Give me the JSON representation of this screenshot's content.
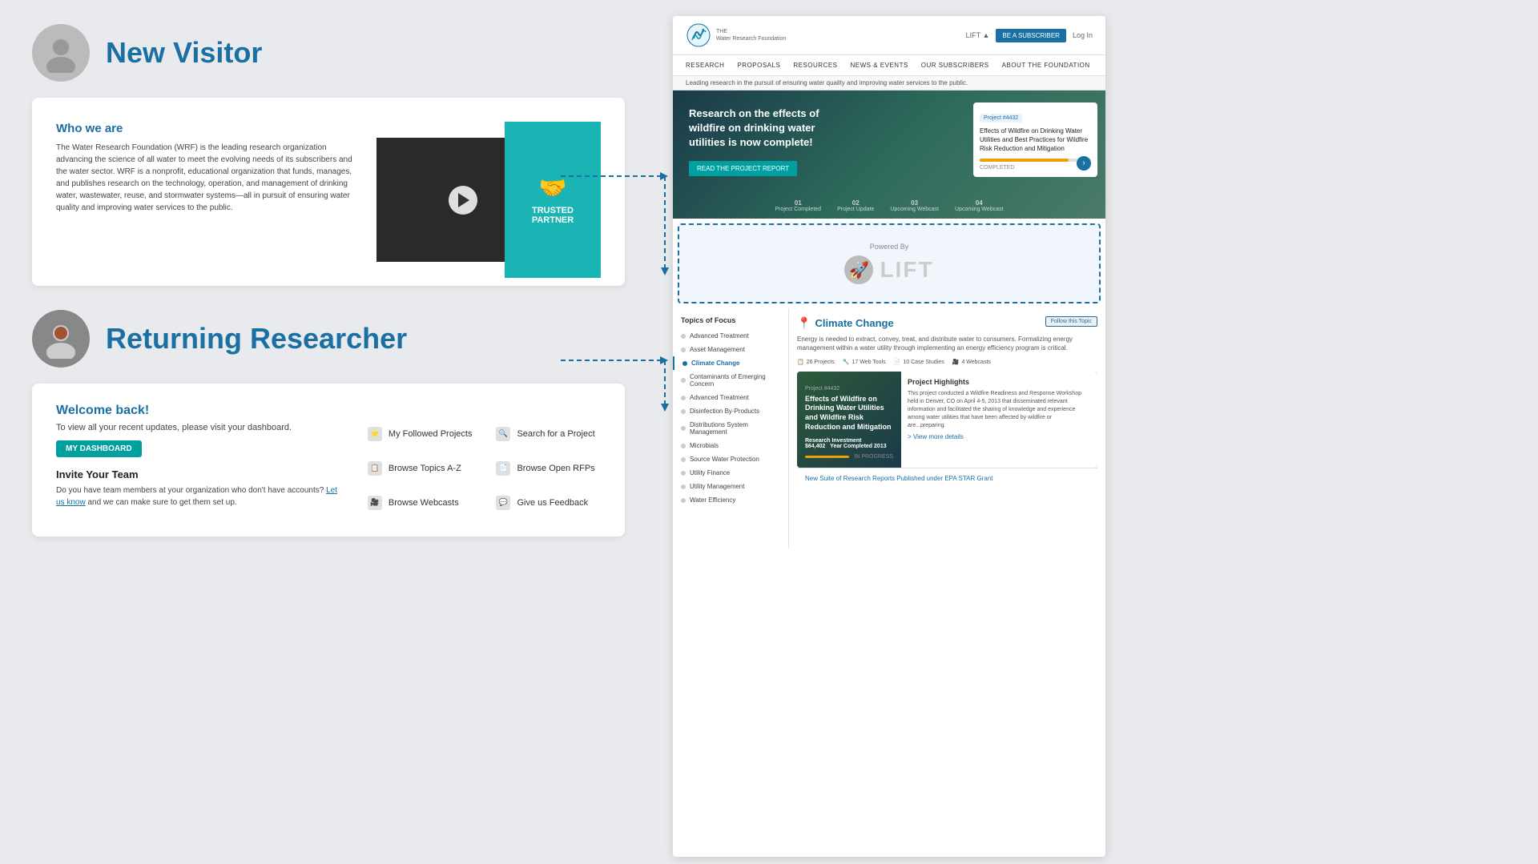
{
  "personas": {
    "new_visitor": {
      "title": "New Visitor",
      "avatar_label": "new-visitor-avatar"
    },
    "returning_researcher": {
      "title": "Returning Researcher",
      "avatar_label": "returning-researcher-avatar"
    }
  },
  "new_visitor_card": {
    "section_title": "Who we are",
    "description": "The Water Research Foundation (WRF) is the leading research organization advancing the science of all water to meet the evolving needs of its subscribers and the water sector. WRF is a nonprofit, educational organization that funds, manages, and publishes research on the technology, operation, and management of drinking water, wastewater, reuse, and stormwater systems—all in pursuit of ensuring water quality and improving water services to the public.",
    "video_overlay_text": "TRUSTED PARTNER"
  },
  "returning_card": {
    "welcome_title": "Welcome back!",
    "welcome_desc": "To view all your recent updates, please visit your dashboard.",
    "dashboard_btn": "MY DASHBOARD",
    "invite_title": "Invite Your Team",
    "invite_desc": "Do you have team members at your organization who don't have accounts?",
    "invite_link": "Let us know",
    "invite_suffix": " and we can make sure to get them set up.",
    "quick_links": [
      {
        "label": "My Followed Projects",
        "icon": "star-icon"
      },
      {
        "label": "Search for a Project",
        "icon": "search-icon"
      },
      {
        "label": "Browse Topics A-Z",
        "icon": "list-icon"
      },
      {
        "label": "Browse Open RFPs",
        "icon": "document-icon"
      },
      {
        "label": "Browse Webcasts",
        "icon": "video-icon"
      },
      {
        "label": "Give us Feedback",
        "icon": "feedback-icon"
      }
    ]
  },
  "wrf_website": {
    "header": {
      "logo_name": "Water Research Foundation",
      "logo_sub": "THE",
      "search_label": "LIFT ▲",
      "subscribe_btn": "BE A SUBSCRIBER",
      "login_label": "Log In"
    },
    "nav_items": [
      "RESEARCH",
      "PROPOSALS",
      "RESOURCES",
      "NEWS & EVENTS",
      "OUR SUBSCRIBERS",
      "ABOUT THE FOUNDATION"
    ],
    "tagline": "Leading research in the pursuit of ensuring water quality and improving water services to the public.",
    "hero": {
      "title": "Research on the effects of wildfire on drinking water utilities is now complete!",
      "cta_btn": "READ THE PROJECT REPORT",
      "card_tag": "Project #4432",
      "card_title": "Effects of Wildfire on Drinking Water Utilities and Best Practices for Wildfire Risk Reduction and Mitigation",
      "card_status": "COMPLETED",
      "nav_items": [
        {
          "num": "01",
          "label": "Project Completed"
        },
        {
          "num": "02",
          "label": "Project Update"
        },
        {
          "num": "03",
          "label": "Upcoming Webcast"
        },
        {
          "num": "04",
          "label": "Upcoming Webcast"
        }
      ]
    },
    "lift_box": {
      "powered_by": "Powered By",
      "logo_text": "LIFT"
    },
    "topics": {
      "title": "Topics of Focus",
      "items": [
        {
          "label": "Advanced Treatment",
          "active": false
        },
        {
          "label": "Asset Management",
          "active": false
        },
        {
          "label": "Climate Change",
          "active": true
        },
        {
          "label": "Contaminants of Emerging Concern",
          "active": false
        },
        {
          "label": "Advanced Treatment",
          "active": false
        },
        {
          "label": "Disinfection By-Products",
          "active": false
        },
        {
          "label": "Distributions System Management",
          "active": false
        },
        {
          "label": "Microbials",
          "active": false
        },
        {
          "label": "Source Water Protection",
          "active": false
        },
        {
          "label": "Utility Finance",
          "active": false
        },
        {
          "label": "Utility Management",
          "active": false
        },
        {
          "label": "Water Efficiency",
          "active": false
        }
      ]
    },
    "climate": {
      "title": "Climate Change",
      "follow_btn": "Follow this Topic",
      "description": "Energy is needed to extract, convey, treat, and distribute water to consumers. Formalizing energy management within a water utility through implementing an energy efficiency program is critical.",
      "stats": [
        {
          "count": "26 Projects",
          "icon": "📋"
        },
        {
          "count": "17 Web Tools",
          "icon": "🔧"
        },
        {
          "count": "10 Case Studies",
          "icon": "📄"
        },
        {
          "count": "4 Webcasts",
          "icon": "🎥"
        }
      ],
      "project": {
        "tag": "Project #4432",
        "title": "Effects of Wildfire on Drinking Water Utilities and Wildfire Risk Reduction and Mitigation",
        "investment": "Research Investment",
        "investment_amount": "$64,402",
        "year_label": "Year Completed",
        "year": "2013",
        "status": "IN PROGRESS",
        "highlights_title": "Project Highlights",
        "highlights_text": "This project conducted a Wildfire Readiness and Response Workshop held in Denver, CO on April 4-5, 2013 that disseminated relevant information and facilitated the sharing of knowledge and experience among water utilities that have been affected by wildfire or are...preparing.",
        "view_details": "> View more details"
      }
    },
    "new_suite_label": "New Suite of Research Reports Published under EPA STAR Grant"
  }
}
